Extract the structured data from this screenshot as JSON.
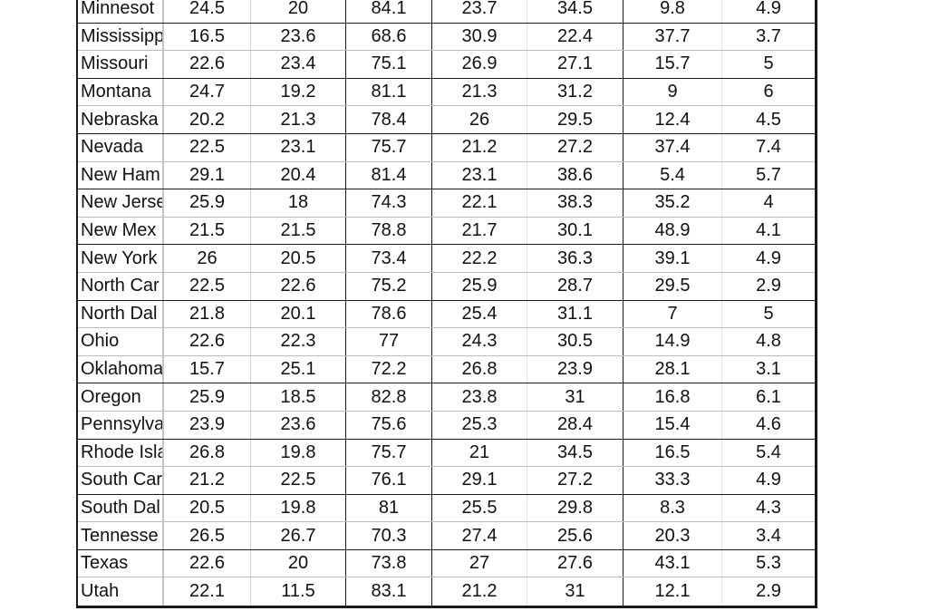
{
  "table": {
    "rows": [
      {
        "state": "Minnesot",
        "values": [
          "24.5",
          "20",
          "84.1",
          "23.7",
          "34.5",
          "9.8",
          "4.9"
        ],
        "dark_bottom": true
      },
      {
        "state": "Mississipp",
        "values": [
          "16.5",
          "23.6",
          "68.6",
          "30.9",
          "22.4",
          "37.7",
          "3.7"
        ],
        "dark_bottom": false
      },
      {
        "state": "Missouri",
        "values": [
          "22.6",
          "23.4",
          "75.1",
          "26.9",
          "27.1",
          "15.7",
          "5"
        ],
        "dark_bottom": true
      },
      {
        "state": "Montana",
        "values": [
          "24.7",
          "19.2",
          "81.1",
          "21.3",
          "31.2",
          "9",
          "6"
        ],
        "dark_bottom": false
      },
      {
        "state": "Nebraska",
        "values": [
          "20.2",
          "21.3",
          "78.4",
          "26",
          "29.5",
          "12.4",
          "4.5"
        ],
        "dark_bottom": true
      },
      {
        "state": "Nevada",
        "values": [
          "22.5",
          "23.1",
          "75.7",
          "21.2",
          "27.2",
          "37.4",
          "7.4"
        ],
        "dark_bottom": false
      },
      {
        "state": "New Ham",
        "values": [
          "29.1",
          "20.4",
          "81.4",
          "23.1",
          "38.6",
          "5.4",
          "5.7"
        ],
        "dark_bottom": true
      },
      {
        "state": "New Jerse",
        "values": [
          "25.9",
          "18",
          "74.3",
          "22.1",
          "38.3",
          "35.2",
          "4"
        ],
        "dark_bottom": false
      },
      {
        "state": "New Mex",
        "values": [
          "21.5",
          "21.5",
          "78.8",
          "21.7",
          "30.1",
          "48.9",
          "4.1"
        ],
        "dark_bottom": true
      },
      {
        "state": "New York",
        "values": [
          "26",
          "20.5",
          "73.4",
          "22.2",
          "36.3",
          "39.1",
          "4.9"
        ],
        "dark_bottom": false
      },
      {
        "state": "North Car",
        "values": [
          "22.5",
          "22.6",
          "75.2",
          "25.9",
          "28.7",
          "29.5",
          "2.9"
        ],
        "dark_bottom": true
      },
      {
        "state": "North Dal",
        "values": [
          "21.8",
          "20.1",
          "78.6",
          "25.4",
          "31.1",
          "7",
          "5"
        ],
        "dark_bottom": false
      },
      {
        "state": "Ohio",
        "values": [
          "22.6",
          "22.3",
          "77",
          "24.3",
          "30.5",
          "14.9",
          "4.8"
        ],
        "dark_bottom": false
      },
      {
        "state": "Oklahoma",
        "values": [
          "15.7",
          "25.1",
          "72.2",
          "26.8",
          "23.9",
          "28.1",
          "3.1"
        ],
        "dark_bottom": true
      },
      {
        "state": "Oregon",
        "values": [
          "25.9",
          "18.5",
          "82.8",
          "23.8",
          "31",
          "16.8",
          "6.1"
        ],
        "dark_bottom": false
      },
      {
        "state": "Pennsylva",
        "values": [
          "23.9",
          "23.6",
          "75.6",
          "25.3",
          "28.4",
          "15.4",
          "4.6"
        ],
        "dark_bottom": true
      },
      {
        "state": "Rhode Isla",
        "values": [
          "26.8",
          "19.8",
          "75.7",
          "21",
          "34.5",
          "16.5",
          "5.4"
        ],
        "dark_bottom": false
      },
      {
        "state": "South Car",
        "values": [
          "21.2",
          "22.5",
          "76.1",
          "29.1",
          "27.2",
          "33.3",
          "4.9"
        ],
        "dark_bottom": true
      },
      {
        "state": "South Dal",
        "values": [
          "20.5",
          "19.8",
          "81",
          "25.5",
          "29.8",
          "8.3",
          "4.3"
        ],
        "dark_bottom": false
      },
      {
        "state": "Tennesse",
        "values": [
          "26.5",
          "26.7",
          "70.3",
          "27.4",
          "25.6",
          "20.3",
          "3.4"
        ],
        "dark_bottom": true
      },
      {
        "state": "Texas",
        "values": [
          "22.6",
          "20",
          "73.8",
          "27",
          "27.6",
          "43.1",
          "5.3"
        ],
        "dark_bottom": false
      },
      {
        "state": "Utah",
        "values": [
          "22.1",
          "11.5",
          "83.1",
          "21.2",
          "31",
          "12.1",
          "2.9"
        ],
        "dark_bottom": true
      }
    ]
  }
}
